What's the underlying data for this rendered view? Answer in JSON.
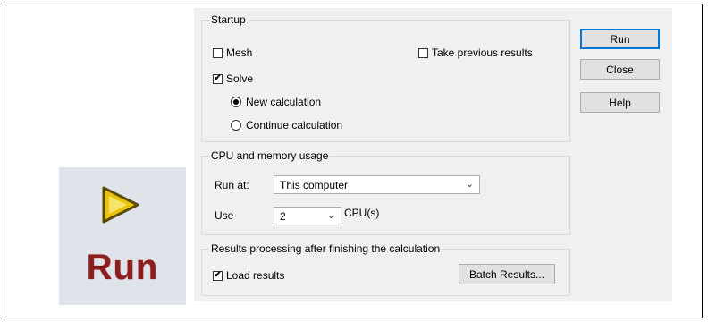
{
  "tile": {
    "icon": "play-triangle-icon",
    "label": "Run",
    "icon_color": "#e8c50a"
  },
  "dialog": {
    "startup": {
      "legend": "Startup",
      "mesh": {
        "label": "Mesh",
        "checked": false
      },
      "take_previous": {
        "label": "Take previous results",
        "checked": false
      },
      "solve": {
        "label": "Solve",
        "checked": true
      },
      "new_calc": {
        "label": "New calculation",
        "selected": true
      },
      "continue_calc": {
        "label": "Continue calculation",
        "selected": false
      }
    },
    "cpu": {
      "legend": "CPU and memory usage",
      "run_at_label": "Run at:",
      "run_at_value": "This computer",
      "use_label": "Use",
      "use_value": "2",
      "cpus_label": "CPU(s)"
    },
    "results": {
      "legend": "Results processing after finishing the calculation",
      "load_results": {
        "label": "Load results",
        "checked": true
      },
      "batch_button": "Batch Results..."
    },
    "buttons": {
      "run": "Run",
      "close": "Close",
      "help": "Help"
    }
  }
}
